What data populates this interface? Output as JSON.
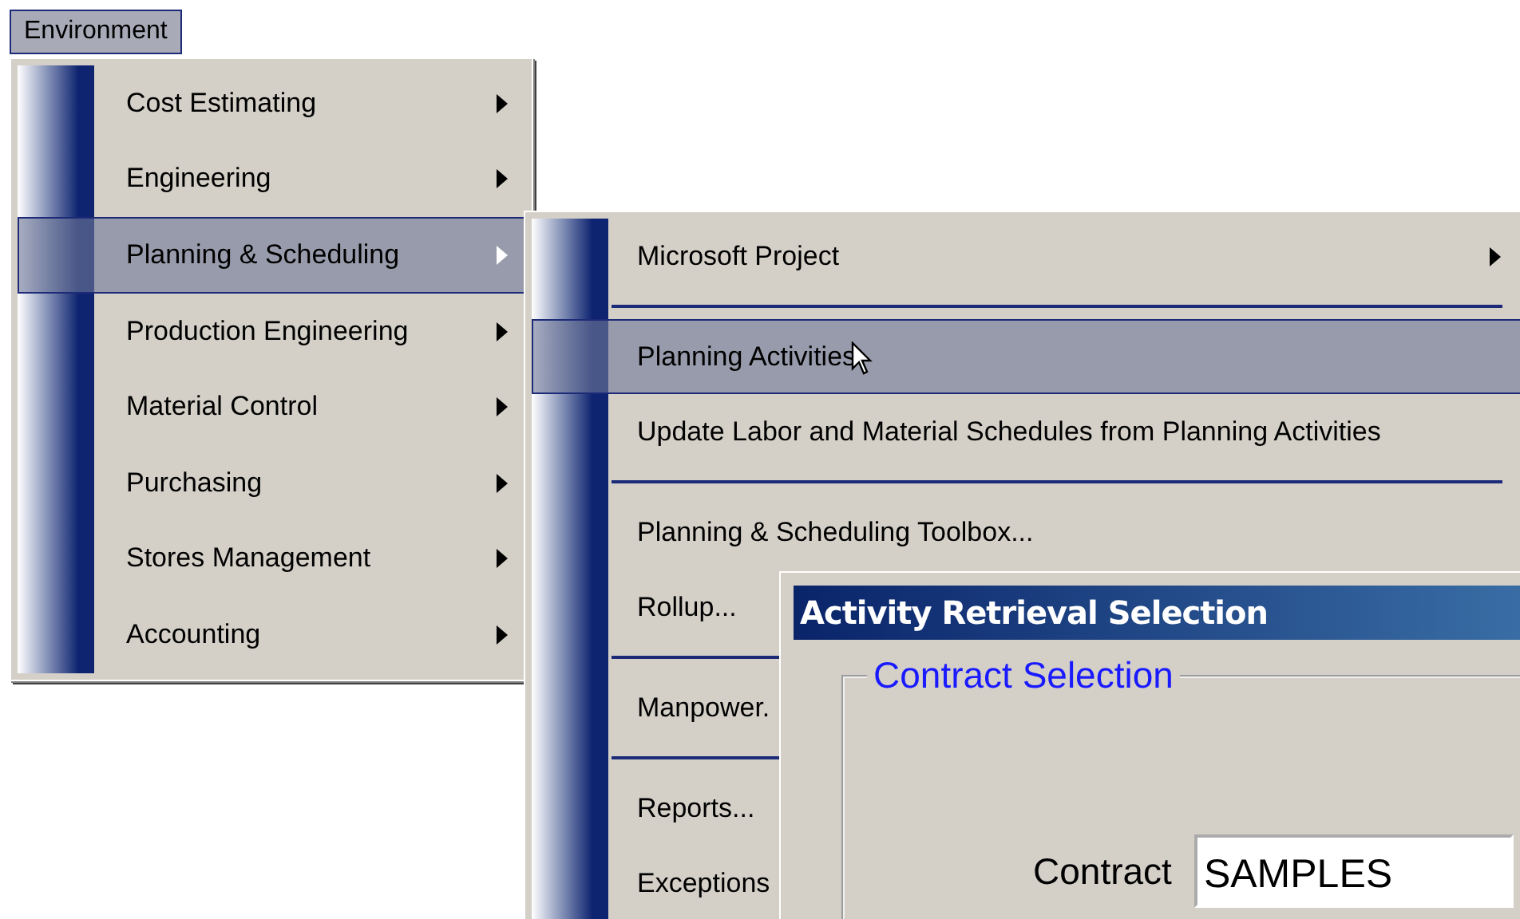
{
  "menu_bar": [
    {
      "label": "Environment",
      "selected": true
    }
  ],
  "main_menu": {
    "items": [
      {
        "label": "Cost Estimating",
        "has_submenu": true,
        "selected": false
      },
      {
        "label": "Engineering",
        "has_submenu": true,
        "selected": false
      },
      {
        "label": "Planning & Scheduling",
        "has_submenu": true,
        "selected": true
      },
      {
        "label": "Production Engineering",
        "has_submenu": true,
        "selected": false
      },
      {
        "label": "Material Control",
        "has_submenu": true,
        "selected": false
      },
      {
        "label": "Purchasing",
        "has_submenu": true,
        "selected": false
      },
      {
        "label": "Stores Management",
        "has_submenu": true,
        "selected": false
      },
      {
        "label": "Accounting",
        "has_submenu": true,
        "selected": false
      }
    ]
  },
  "submenu": {
    "items": [
      {
        "kind": "item",
        "label": "Microsoft Project",
        "has_submenu": true,
        "selected": false
      },
      {
        "kind": "separator"
      },
      {
        "kind": "item",
        "label": "Planning Activities",
        "has_submenu": false,
        "selected": true
      },
      {
        "kind": "item",
        "label": "Update Labor and Material Schedules from Planning Activities",
        "has_submenu": false,
        "selected": false
      },
      {
        "kind": "separator"
      },
      {
        "kind": "item",
        "label": "Planning & Scheduling Toolbox...",
        "has_submenu": false,
        "selected": false
      },
      {
        "kind": "item",
        "label": "Rollup...",
        "selected": false
      },
      {
        "kind": "separator"
      },
      {
        "kind": "item",
        "label": "Manpower.",
        "selected": false
      },
      {
        "kind": "separator"
      },
      {
        "kind": "item",
        "label": "Reports...",
        "selected": false
      },
      {
        "kind": "item",
        "label": "Exceptions",
        "selected": false
      }
    ]
  },
  "dialog": {
    "title": "Activity Retrieval Selection",
    "group": {
      "title": "Contract Selection",
      "fields": [
        {
          "label": "Contract",
          "value": "SAMPLES"
        }
      ]
    }
  }
}
